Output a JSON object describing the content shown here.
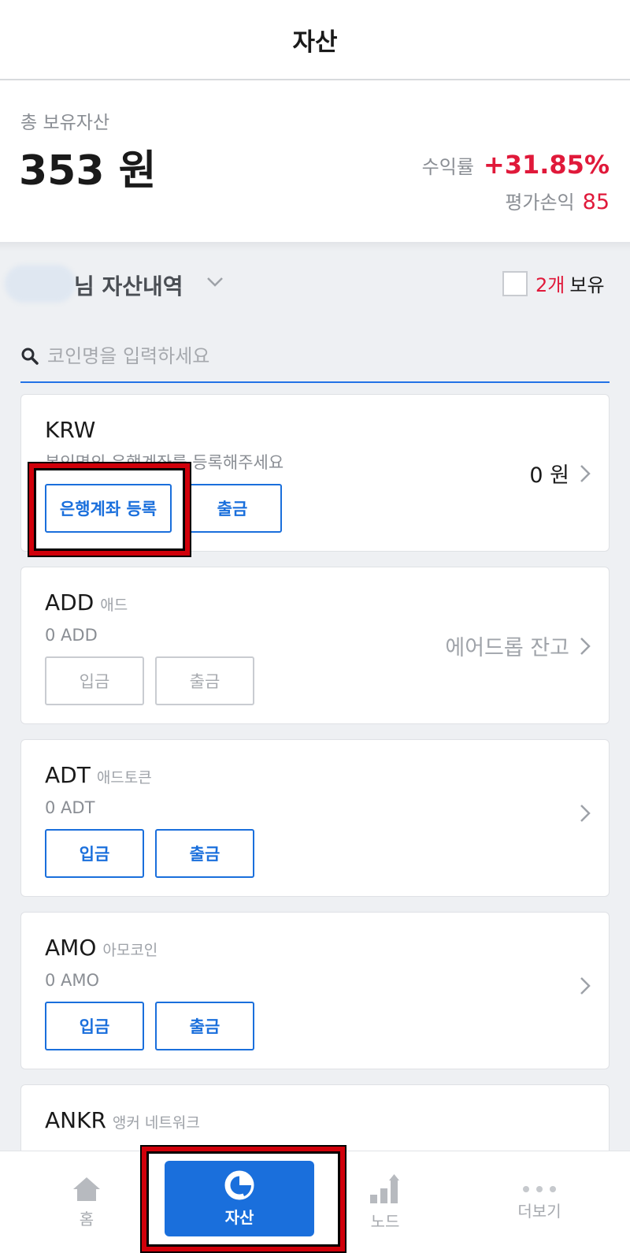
{
  "header": {
    "title": "자산"
  },
  "summary": {
    "label": "총 보유자산",
    "total": "353 원",
    "rate_label": "수익률",
    "rate_value": "+31.85%",
    "pl_label": "평가손익",
    "pl_value": "85"
  },
  "owner": {
    "title": "님 자산내역",
    "count": "2개",
    "owned_label": "보유"
  },
  "search": {
    "placeholder": "코인명을 입력하세요",
    "value": ""
  },
  "cards": [
    {
      "symbol": "KRW",
      "name": "",
      "sub": "본인명의 은행계좌를 등록해주세요",
      "btn1": "은행계좌 등록",
      "btn2": "출금",
      "right": "0 원"
    },
    {
      "symbol": "ADD",
      "name": "애드",
      "sub": "0 ADD",
      "btn1": "입금",
      "btn2": "출금",
      "right": "에어드롭 잔고"
    },
    {
      "symbol": "ADT",
      "name": "애드토큰",
      "sub": "0 ADT",
      "btn1": "입금",
      "btn2": "출금",
      "right": ""
    },
    {
      "symbol": "AMO",
      "name": "아모코인",
      "sub": "0 AMO",
      "btn1": "입금",
      "btn2": "출금",
      "right": ""
    },
    {
      "symbol": "ANKR",
      "name": "앵커 네트워크"
    }
  ],
  "nav": {
    "home": "홈",
    "assets": "자산",
    "node": "노드",
    "more": "더보기"
  },
  "colors": {
    "accent": "#1a6fdc",
    "positive": "#e0193a",
    "highlight": "#d0000a"
  }
}
